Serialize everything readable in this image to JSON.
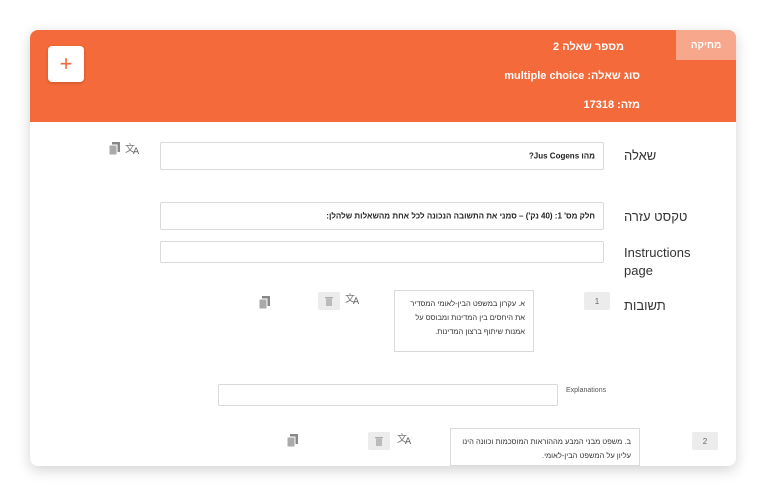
{
  "header": {
    "delete_label": "מחיקה",
    "question_number": "מספר שאלה 2",
    "question_type": "סוג שאלה: multiple choice",
    "question_id": "מזה: 17318",
    "add_label": "+"
  },
  "form": {
    "question_label": "שאלה",
    "question_value": "מהו Jus Cogens?",
    "help_text_label": "טקסט עזרה",
    "help_text_value": "חלק מס' 1: (40 נק') – סמני את התשובה הנכונה לכל אחת מהשאלות שלהלן:",
    "instructions_label": "Instructions page",
    "instructions_value": "",
    "answers_label": "תשובות"
  },
  "answers": [
    {
      "number": "1",
      "text": "א. עקרון במשפט הבין-לאומי המסדיר את היחסים בין המדינות ומבוסס על אמנות שיתוף ברצון המדינות.",
      "explanations_label": "Explanations",
      "explanations_value": ""
    },
    {
      "number": "2",
      "text": "ב. משפט מבני המבע מההוראות המוסכמות וכוונה הינו עליון על המשפט הבין-לאומי."
    }
  ],
  "icons": {
    "copy": "copy-icon",
    "translate": "translate-icon",
    "trash": "trash-icon"
  },
  "colors": {
    "header": "#f46a3a",
    "delete_button": "#f7a78c"
  }
}
